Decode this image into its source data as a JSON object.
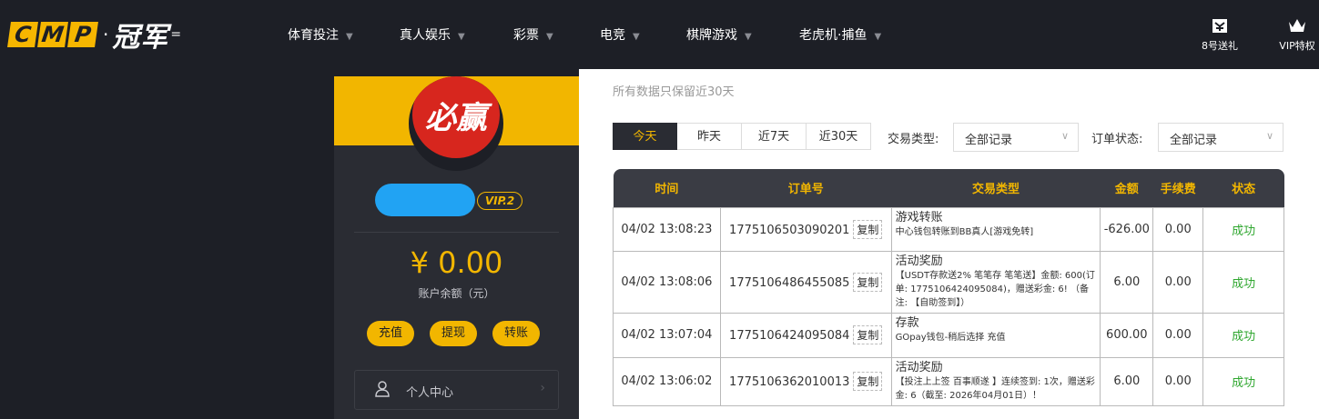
{
  "header": {
    "logo_letters": [
      "C",
      "M",
      "P"
    ],
    "logo_sep": "·",
    "logo_cn": "冠军",
    "nav": [
      {
        "label": "体育投注"
      },
      {
        "label": "真人娱乐"
      },
      {
        "label": "彩票"
      },
      {
        "label": "电竞"
      },
      {
        "label": "棋牌游戏"
      },
      {
        "label": "老虎机·捕鱼"
      }
    ],
    "right_icons": [
      {
        "label": "8号送礼",
        "icon": "gift-icon"
      },
      {
        "label": "VIP特权",
        "icon": "crown-icon"
      }
    ]
  },
  "sidebar": {
    "avatar_text": "必赢",
    "vip_level": "VIP.2",
    "balance": "¥ 0.00",
    "balance_label": "账户余额（元）",
    "actions": [
      "充值",
      "提现",
      "转账"
    ],
    "menu_item": "个人中心"
  },
  "main": {
    "notice": "所有数据只保留近30天",
    "date_tabs": [
      "今天",
      "昨天",
      "近7天",
      "近30天"
    ],
    "active_tab": "今天",
    "tx_type_label": "交易类型:",
    "tx_type_value": "全部记录",
    "order_status_label": "订单状态:",
    "order_status_value": "全部记录",
    "columns": [
      "时间",
      "订单号",
      "交易类型",
      "金额",
      "手续费",
      "状态"
    ],
    "copy_label": "复制",
    "rows": [
      {
        "time": "04/02 13:08:23",
        "order": "1775106503090201",
        "type_title": "游戏转账",
        "type_desc": "中心钱包转账到BB真人[游戏免转]",
        "amount": "-626.00",
        "fee": "0.00",
        "status": "成功"
      },
      {
        "time": "04/02 13:08:06",
        "order": "1775106486455085",
        "type_title": "活动奖励",
        "type_desc": "【USDT存款送2% 笔笔存 笔笔送】金额: 600(订单: 1775106424095084)，赠送彩金: 6! （备注: 【自助签到】）",
        "amount": "6.00",
        "fee": "0.00",
        "status": "成功"
      },
      {
        "time": "04/02 13:07:04",
        "order": "1775106424095084",
        "type_title": "存款",
        "type_desc": "GOpay钱包-稍后选择 充值",
        "amount": "600.00",
        "fee": "0.00",
        "status": "成功"
      },
      {
        "time": "04/02 13:06:02",
        "order": "1775106362010013",
        "type_title": "活动奖励",
        "type_desc": "【投注上上签 百事顺遂 】连续签到: 1次，赠送彩金: 6（截至: 2026年04月01日）！",
        "amount": "6.00",
        "fee": "0.00",
        "status": "成功"
      }
    ]
  },
  "colors": {
    "accent": "#f2b600",
    "dark_bg": "#1d1f26",
    "panel_bg": "#2a2c33",
    "success": "#2fa72f"
  }
}
